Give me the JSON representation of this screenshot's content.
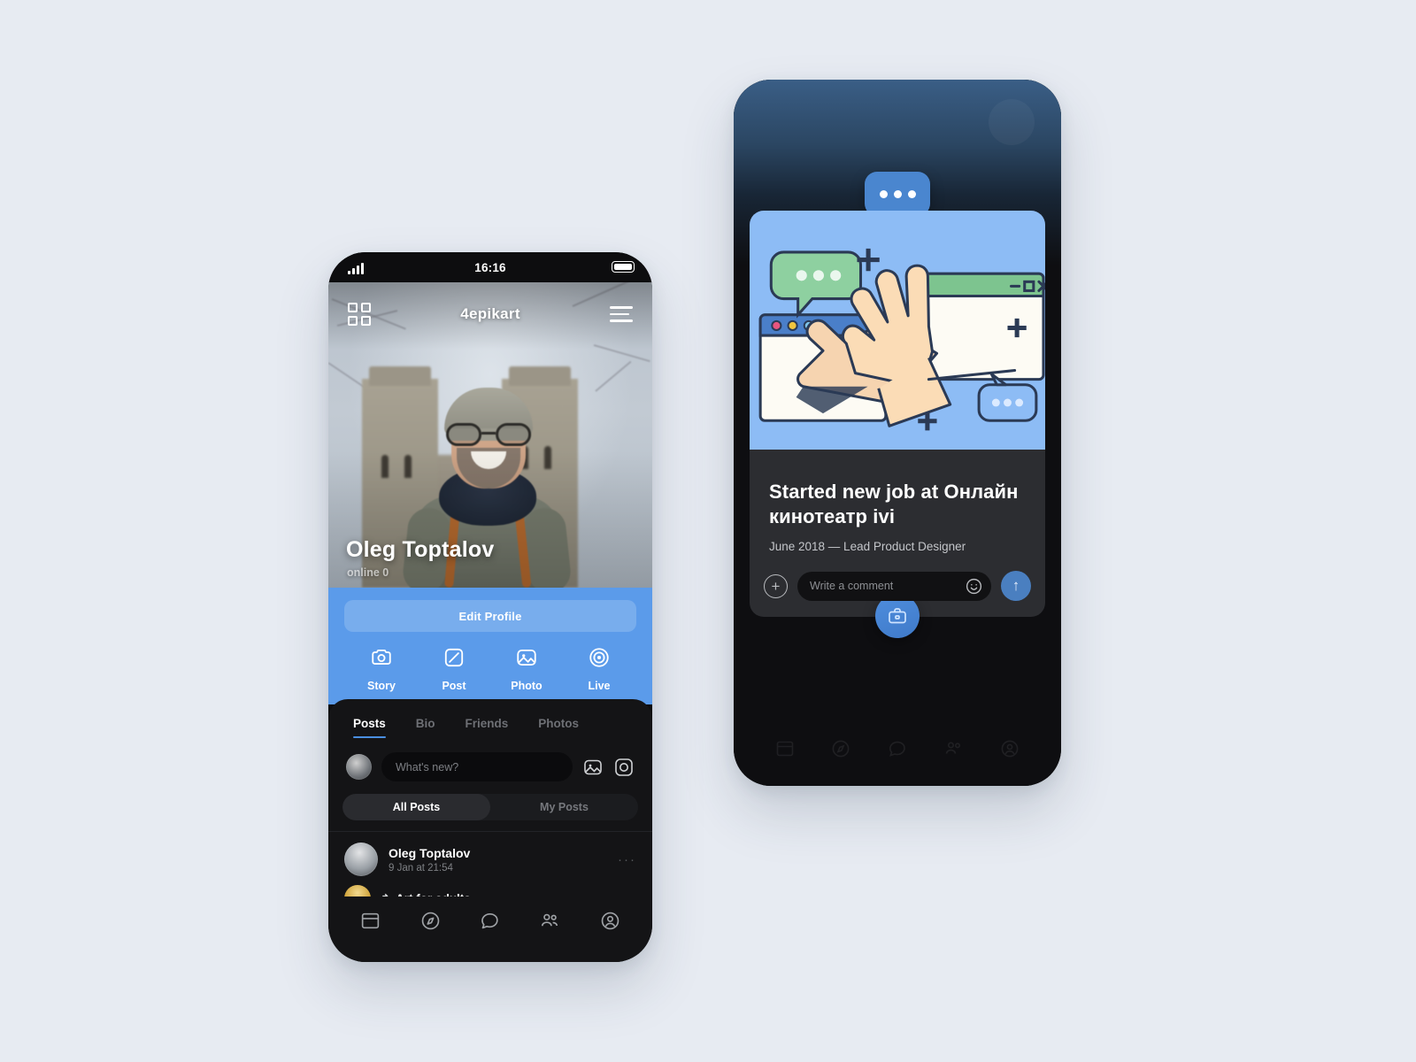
{
  "background_color": "#e7ebf2",
  "accent_color": "#5b9bea",
  "left_phone": {
    "status_bar": {
      "time": "16:16",
      "signal_icon": "signal-bars-icon",
      "battery_icon": "battery-full-icon"
    },
    "header": {
      "qr_icon": "qr-code-icon",
      "title": "4epikart",
      "menu_icon": "hamburger-menu-icon"
    },
    "profile": {
      "name": "Oleg Toptalov",
      "status": "online 0"
    },
    "edit_profile_label": "Edit Profile",
    "quick_actions": [
      {
        "label": "Story",
        "icon": "camera-icon"
      },
      {
        "label": "Post",
        "icon": "edit-square-icon"
      },
      {
        "label": "Photo",
        "icon": "image-icon"
      },
      {
        "label": "Live",
        "icon": "live-target-icon"
      }
    ],
    "tabs": [
      {
        "label": "Posts",
        "active": true
      },
      {
        "label": "Bio",
        "active": false
      },
      {
        "label": "Friends",
        "active": false
      },
      {
        "label": "Photos",
        "active": false
      }
    ],
    "composer": {
      "placeholder": "What's new?",
      "avatar": "user-avatar",
      "image_icon": "image-icon",
      "camera_icon": "camera-icon"
    },
    "feed_filter": [
      {
        "label": "All Posts",
        "active": true
      },
      {
        "label": "My Posts",
        "active": false
      }
    ],
    "posts": [
      {
        "author": "Oleg Toptalov",
        "timestamp": "9 Jan at 21:54",
        "more_icon": "more-dots-icon"
      },
      {
        "shared_title": "Art for adults",
        "share_icon": "share-arrow-icon"
      }
    ],
    "bottom_nav": [
      {
        "icon": "feed-icon",
        "active": false
      },
      {
        "icon": "compass-icon",
        "active": false
      },
      {
        "icon": "chat-icon",
        "active": false
      },
      {
        "icon": "friends-icon",
        "active": false
      },
      {
        "icon": "profile-icon",
        "active": true
      }
    ]
  },
  "right_phone": {
    "illustration": {
      "name": "high-five-hands-illustration",
      "background_color": "#8dbcf5",
      "elements": [
        "browser-window-blue",
        "browser-window-green",
        "chat-bubble-green",
        "chat-bubble-blue",
        "chat-bubble-outline",
        "plus-sparkles",
        "high-five-hands"
      ]
    },
    "floating_chat_icon": "chat-dots-icon",
    "badge_icon": "briefcase-icon",
    "post": {
      "title": "Started new job at Онлайн кинотеатр ivi",
      "subtitle": "June 2018 — Lead Product Designer"
    },
    "comment_bar": {
      "add_icon": "plus-circle-icon",
      "placeholder": "Write a comment",
      "emoji_icon": "smiley-icon",
      "send_icon": "arrow-up-icon"
    },
    "bottom_nav": [
      {
        "icon": "feed-icon"
      },
      {
        "icon": "compass-icon"
      },
      {
        "icon": "chat-icon"
      },
      {
        "icon": "friends-icon"
      },
      {
        "icon": "profile-icon"
      }
    ]
  }
}
